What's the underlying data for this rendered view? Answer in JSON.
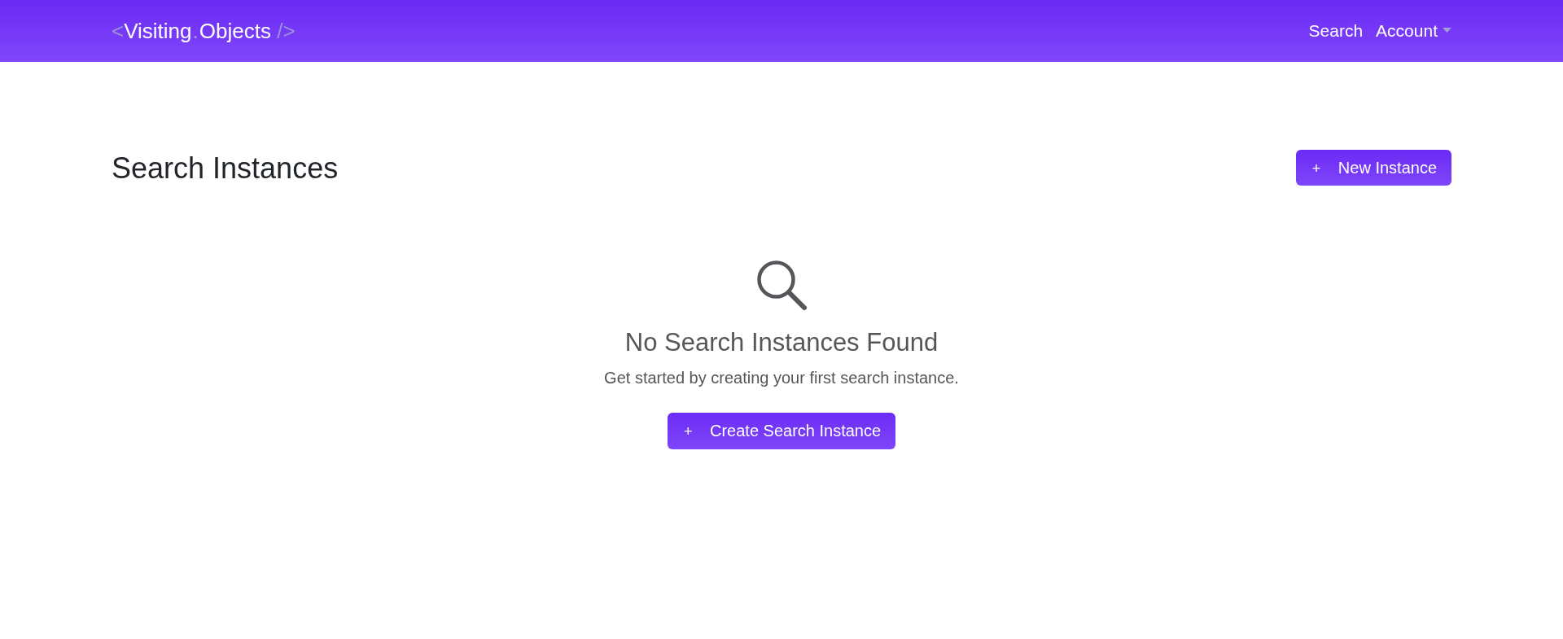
{
  "navbar": {
    "brand": [
      {
        "kind": "bracket",
        "text": "<"
      },
      {
        "kind": "word",
        "text": "Visiting"
      },
      {
        "kind": "separator",
        "text": "."
      },
      {
        "kind": "word",
        "text": "Objects"
      },
      {
        "kind": "bracket",
        "text": "/>"
      }
    ],
    "links": [
      {
        "label": "Search",
        "dropdown": false
      },
      {
        "label": "Account",
        "dropdown": true
      }
    ]
  },
  "page": {
    "title": "Search Instances",
    "action": {
      "icon": "+",
      "label": "New Instance"
    }
  },
  "empty_state": {
    "title": "No Search Instances Found",
    "message": "Get started by creating your first search instance.",
    "action": {
      "icon": "+",
      "label": "Create Search Instance"
    }
  }
}
